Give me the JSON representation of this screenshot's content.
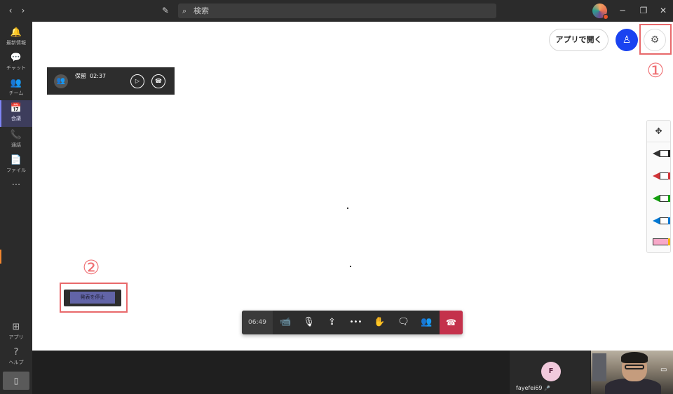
{
  "titlebar": {
    "back_icon": "‹",
    "forward_icon": "›",
    "compose_icon": "✎",
    "search_placeholder": "検索",
    "minimize": "─",
    "restore": "❐",
    "close": "✕"
  },
  "rail": {
    "items": [
      {
        "label": "最新情報",
        "icon": "bell-icon",
        "glyph": "🔔"
      },
      {
        "label": "チャット",
        "icon": "chat-icon",
        "glyph": "💬"
      },
      {
        "label": "チーム",
        "icon": "teams-icon",
        "glyph": "👥"
      },
      {
        "label": "会議",
        "icon": "calendar-icon",
        "glyph": "📅"
      },
      {
        "label": "通話",
        "icon": "phone-icon",
        "glyph": "📞"
      },
      {
        "label": "ファイル",
        "icon": "file-icon",
        "glyph": "📄"
      },
      {
        "label": "",
        "icon": "more-icon",
        "glyph": "···"
      }
    ],
    "bottom_items": [
      {
        "label": "アプリ",
        "icon": "apps-icon",
        "glyph": "⊞"
      },
      {
        "label": "ヘルプ",
        "icon": "help-icon",
        "glyph": "?"
      }
    ],
    "mobile_glyph": "▯",
    "active_index": 3
  },
  "whiteboard": {
    "open_in_app": "アプリで開く",
    "person_glyph": "♙",
    "gear_glyph": "⚙",
    "annotation_1": "①",
    "annotation_2": "②"
  },
  "hold_panel": {
    "label": "保留",
    "time": "02:37",
    "play_glyph": "▷",
    "hangup_glyph": "☎"
  },
  "stop_presenting": {
    "label": "発表を停止"
  },
  "pen_tray": {
    "move_glyph": "✥",
    "pens": [
      {
        "name": "black-pen",
        "color": "#222222"
      },
      {
        "name": "red-pen",
        "color": "#d13438"
      },
      {
        "name": "green-pen",
        "color": "#13a10e"
      },
      {
        "name": "blue-pen",
        "color": "#0078d4"
      },
      {
        "name": "highlighter",
        "color": "#f7a8c8"
      }
    ]
  },
  "call_controls": {
    "timer": "06:49",
    "camera": "📹",
    "mic": "🎙",
    "share": "⇪",
    "more": "•••",
    "raise_hand": "✋",
    "chat": "🗨",
    "participants": "👥",
    "hangup": "☎"
  },
  "participants": {
    "name": "fayefei69",
    "initial": "F",
    "muted_glyph": "🎤"
  },
  "colors": {
    "accent": "#6264a7",
    "hangup": "#c4314b",
    "annotation": "#ef6f73",
    "person_button": "#1a43f0"
  }
}
